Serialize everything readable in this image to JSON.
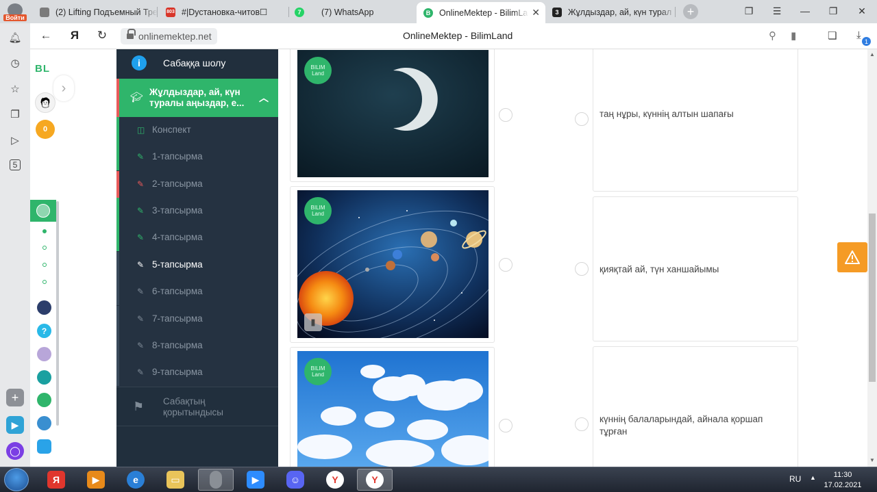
{
  "browser": {
    "login_label": "Войти",
    "tabs": [
      {
        "label": "(2) Lifting Подъемный Тре",
        "favicon": "youtube",
        "active": false
      },
      {
        "label": "#|Dустановка-читов☐",
        "favicon": "803",
        "active": false
      },
      {
        "label": "(7) WhatsApp",
        "favicon": "whatsapp",
        "active": false
      },
      {
        "label": "OnlineMektep - BilimLa",
        "favicon": "onlinemektep",
        "active": true
      },
      {
        "label": "Жұлдыздар, ай, күн турал",
        "favicon": "3",
        "active": false
      }
    ],
    "new_tab_label": "+",
    "address": "onlinemektep.net",
    "page_title": "OnlineMektep - BilimLand",
    "downloads_badge": "1"
  },
  "site_rail": {
    "logo": "BL",
    "coins": "0"
  },
  "course_menu": {
    "overview": "Сабаққа шолу",
    "topic": "Жұлдыздар, ай, күн туралы аңыздар, е...",
    "items": [
      {
        "label": "Конспект",
        "icon": "book-icon",
        "status": "none"
      },
      {
        "label": "1-тапсырма",
        "icon": "edit-icon",
        "status": "done"
      },
      {
        "label": "2-тапсырма",
        "icon": "edit-icon",
        "status": "wrong"
      },
      {
        "label": "3-тапсырма",
        "icon": "edit-icon",
        "status": "done"
      },
      {
        "label": "4-тапсырма",
        "icon": "edit-icon",
        "status": "done"
      },
      {
        "label": "5-тапсырма",
        "icon": "edit-icon",
        "status": "current"
      },
      {
        "label": "6-тапсырма",
        "icon": "edit-icon",
        "status": "none"
      },
      {
        "label": "7-тапсырма",
        "icon": "edit-icon",
        "status": "none"
      },
      {
        "label": "8-тапсырма",
        "icon": "edit-icon",
        "status": "none"
      },
      {
        "label": "9-тапсырма",
        "icon": "edit-icon",
        "status": "none"
      }
    ],
    "conclusion": "Сабақтың қорытындысы"
  },
  "task": {
    "badge_text": [
      "BILIM",
      "Land"
    ],
    "images": [
      "crescent-moon",
      "solar-system",
      "clouds-sky"
    ],
    "answers": [
      "таң нұры, күннің алтын шапағы",
      "қияқтай ай, түн ханшайымы",
      "күннің балаларындай, айнала қоршап тұрған"
    ]
  },
  "taskbar": {
    "language": "RU",
    "time": "11:30",
    "date": "17.02.2021"
  },
  "colors": {
    "accent_green": "#2fb56b",
    "menu_bg": "#212f3d",
    "wrong_red": "#e85a5a",
    "warning_orange": "#f59b25"
  }
}
